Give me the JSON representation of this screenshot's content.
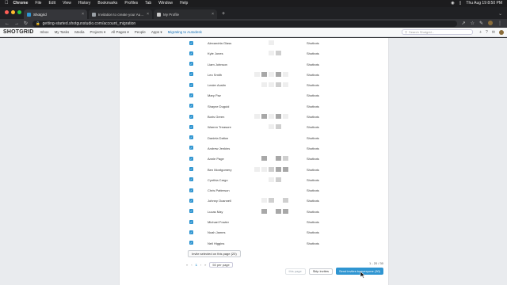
{
  "menubar": {
    "app": "Chrome",
    "items": [
      "File",
      "Edit",
      "View",
      "History",
      "Bookmarks",
      "Profiles",
      "Tab",
      "Window",
      "Help"
    ],
    "datetime": "Thu Aug 19  8:50 PM"
  },
  "tabs": [
    {
      "label": "Shotgrid"
    },
    {
      "label": "Invitation to create your Autod..."
    },
    {
      "label": "My Profile"
    }
  ],
  "address": {
    "url": "getting-started.shotgunstudio.com/account_migration"
  },
  "nav": {
    "logo": "SHOTGRID",
    "items": [
      "Inbox",
      "My Tasks",
      "Media",
      "Projects ▾",
      "All Pages ▾",
      "People",
      "Apps ▾",
      "Migrating to Autodesk"
    ],
    "search_placeholder": "Search Shotgrid..."
  },
  "colors": {
    "accent": "#2f95d1",
    "brand": "#222222"
  },
  "users": [
    {
      "name": "Alexandria Glass",
      "group": "Shotbots",
      "pattern": [
        0,
        0,
        1,
        0,
        0
      ]
    },
    {
      "name": "Kyle Jones",
      "group": "Shotbots",
      "pattern": [
        0,
        0,
        1,
        2,
        0
      ]
    },
    {
      "name": "Liam Johnson",
      "group": "Shotbots",
      "pattern": [
        0,
        0,
        0,
        0,
        0
      ]
    },
    {
      "name": "Leo Smith",
      "group": "Shotbots",
      "pattern": [
        1,
        3,
        1,
        3,
        1
      ]
    },
    {
      "name": "Lester Austin",
      "group": "Shotbots",
      "pattern": [
        0,
        1,
        1,
        2,
        1
      ]
    },
    {
      "name": "Mary Paz",
      "group": "Shotbots",
      "pattern": [
        0,
        0,
        0,
        0,
        0
      ]
    },
    {
      "name": "Shayne Duguid",
      "group": "Shotbots",
      "pattern": [
        0,
        0,
        0,
        0,
        0
      ]
    },
    {
      "name": "Boris Green",
      "group": "Shotbots",
      "pattern": [
        1,
        3,
        1,
        3,
        1
      ]
    },
    {
      "name": "Warren Treasure",
      "group": "Shotbots",
      "pattern": [
        0,
        0,
        1,
        2,
        0
      ]
    },
    {
      "name": "Daniela Dalton",
      "group": "Shotbots",
      "pattern": [
        0,
        0,
        0,
        0,
        0
      ]
    },
    {
      "name": "Andrew Jenkins",
      "group": "Shotbots",
      "pattern": [
        0,
        0,
        0,
        0,
        0
      ]
    },
    {
      "name": "Annie Page",
      "group": "Shotbots",
      "pattern": [
        0,
        3,
        0,
        3,
        2
      ]
    },
    {
      "name": "Ben Montgomery",
      "group": "Shotbots",
      "pattern": [
        1,
        1,
        2,
        3,
        3
      ]
    },
    {
      "name": "Cynthia Cargo",
      "group": "Shotbots",
      "pattern": [
        0,
        0,
        1,
        2,
        0
      ]
    },
    {
      "name": "Chris Patterson",
      "group": "Shotbots",
      "pattern": [
        0,
        0,
        0,
        0,
        0
      ]
    },
    {
      "name": "Johnny Ocannell",
      "group": "Shotbots",
      "pattern": [
        0,
        1,
        2,
        0,
        2
      ]
    },
    {
      "name": "Lucas May",
      "group": "Shotbots",
      "pattern": [
        0,
        3,
        0,
        3,
        3
      ]
    },
    {
      "name": "Michael Fowler",
      "group": "Shotbots",
      "pattern": [
        0,
        0,
        0,
        0,
        0
      ]
    },
    {
      "name": "Noah James",
      "group": "Shotbots",
      "pattern": [
        0,
        0,
        0,
        0,
        0
      ]
    },
    {
      "name": "Neil Higgins",
      "group": "Shotbots",
      "pattern": [
        0,
        0,
        0,
        0,
        0
      ]
    }
  ],
  "invite_page_label": "Invite selected on this page (20)",
  "pagination": {
    "current": "1",
    "per_page": "50 per page",
    "range": "1 - 20 / 30"
  },
  "actions": {
    "this_page_label": "this page",
    "skip_label": "Skip invites",
    "send_label": "Send invites to everyone (30)"
  }
}
